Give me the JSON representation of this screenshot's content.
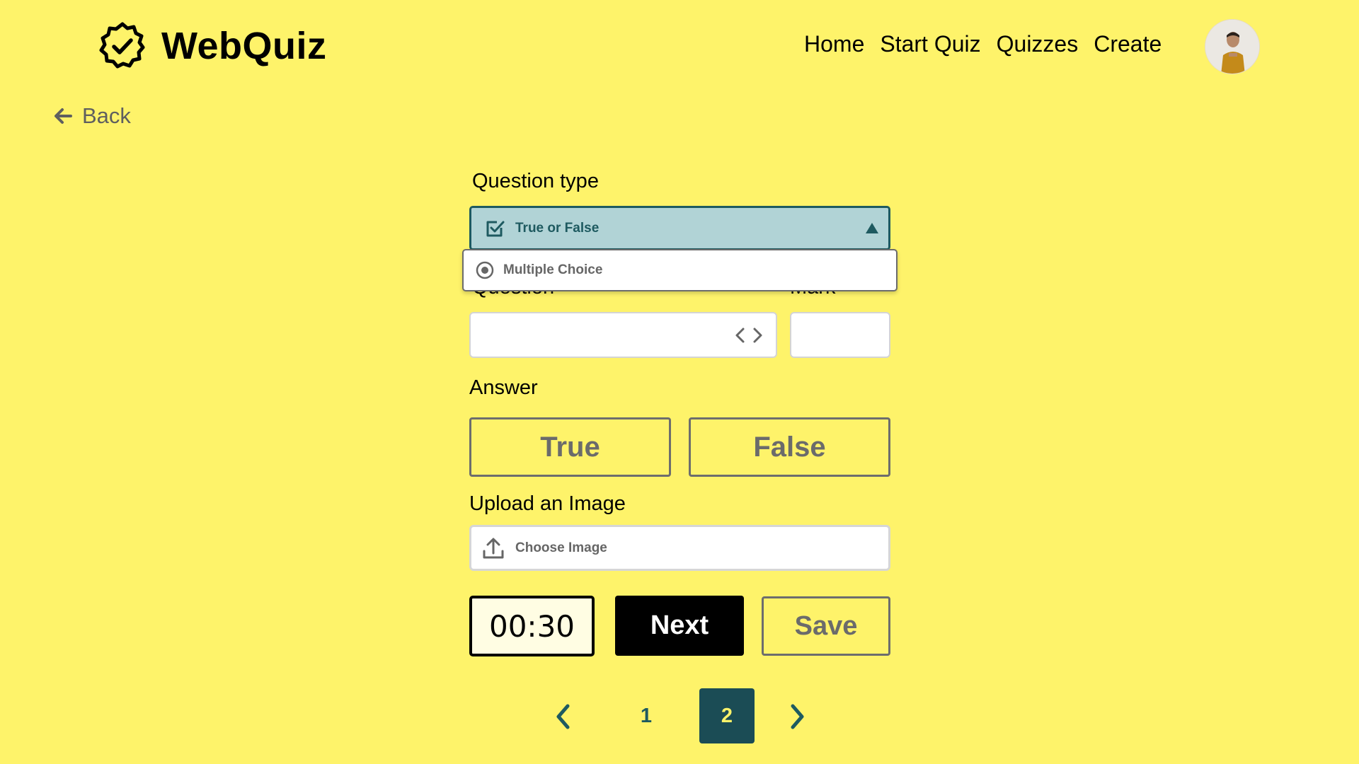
{
  "header": {
    "logo_text": "WebQuiz",
    "logo_icon": "badge-check-icon",
    "nav": [
      "Home",
      "Start Quiz",
      "Quizzes",
      "Create"
    ],
    "avatar": "user-avatar"
  },
  "back_label": "Back",
  "form": {
    "question_type_label": "Question type",
    "question_type_selected": "True or False",
    "question_type_options": [
      "Multiple Choice"
    ],
    "question_label": "Question",
    "mark_label": "Mark",
    "question_value": "",
    "mark_value": "",
    "answer_label": "Answer",
    "answers": [
      "True",
      "False"
    ],
    "upload_label": "Upload an Image",
    "upload_button": "Choose Image",
    "timer": "00:30",
    "next_label": "Next",
    "save_label": "Save"
  },
  "pagination": {
    "pages": [
      "1",
      "2"
    ],
    "current": "2"
  },
  "colors": {
    "background": "#fef36a",
    "accent": "#1e5a60",
    "select_bg": "#b1d3d6",
    "active_page": "#1b4c55"
  }
}
